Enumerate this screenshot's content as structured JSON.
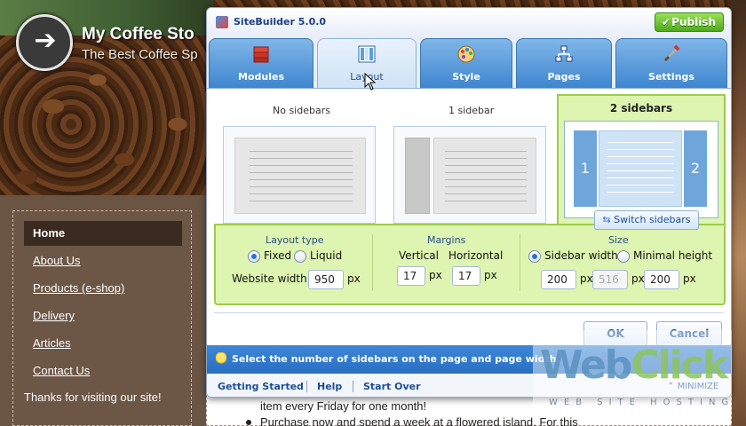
{
  "website": {
    "title": "My Coffee Sto",
    "subtitle": "The Best Coffee Sp",
    "nav": [
      "Home",
      "About Us",
      "Products (e-shop)",
      "Delivery",
      "Articles",
      "Contact Us"
    ],
    "active_nav": "Home",
    "thanks": "Thanks for visiting our site!",
    "content_lines": [
      "item every Friday for one month!",
      "Purchase now and spend a week at a flowered island. For this"
    ]
  },
  "dialog": {
    "app_title": "SiteBuilder 5.0.0",
    "publish_label": "Publish",
    "tabs": [
      {
        "label": "Modules",
        "icon": "modules-icon"
      },
      {
        "label": "Layout",
        "icon": "layout-icon"
      },
      {
        "label": "Style",
        "icon": "style-icon"
      },
      {
        "label": "Pages",
        "icon": "pages-icon"
      },
      {
        "label": "Settings",
        "icon": "settings-icon"
      }
    ],
    "active_tab": "Layout",
    "layout_options": [
      "No sidebars",
      "1 sidebar",
      "2 sidebars"
    ],
    "selected_layout": "2 sidebars",
    "sidebar_numbers": [
      "1",
      "2"
    ],
    "switch_sidebars_label": "Switch sidebars",
    "layout_type": {
      "title": "Layout type",
      "options": [
        "Fixed",
        "Liquid"
      ],
      "selected": "Fixed",
      "website_width_label": "Website width",
      "website_width_value": "950",
      "unit": "px"
    },
    "margins": {
      "title": "Margins",
      "vertical_label": "Vertical",
      "horizontal_label": "Horizontal",
      "vertical_value": "17",
      "horizontal_value": "17",
      "unit": "px"
    },
    "size": {
      "title": "Size",
      "options": [
        "Sidebar width",
        "Minimal height"
      ],
      "selected": "Sidebar width",
      "values": [
        "200",
        "516",
        "200"
      ],
      "unit": "px"
    },
    "ok_label": "OK",
    "cancel_label": "Cancel",
    "info_text": "Select the number of sidebars on the page and page width.",
    "footer_links": [
      "Getting Started",
      "Help",
      "Start Over"
    ],
    "minimize_label": "MINIMIZE"
  },
  "watermark": {
    "brand_a": "Web",
    "brand_b": "Click",
    "sub": "WEB SITE HOSTING"
  },
  "colors": {
    "accent_blue": "#2a6fc2",
    "selected_green": "#ddf5b0",
    "publish_green": "#4eaa1c"
  }
}
